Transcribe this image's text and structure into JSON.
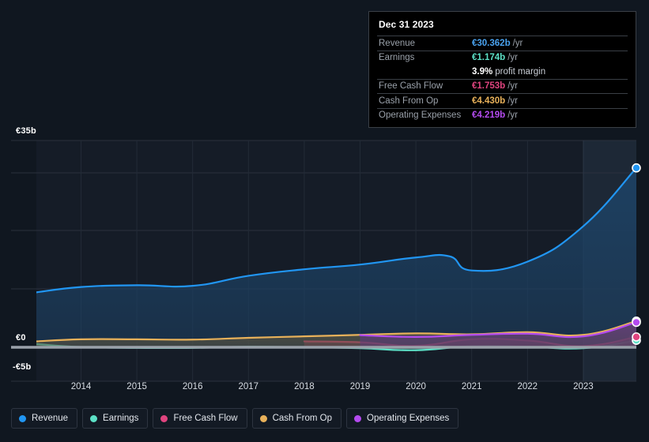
{
  "chart_data": {
    "type": "area",
    "title": "",
    "xlabel": "",
    "ylabel": "",
    "currency": "EUR",
    "x": [
      2013.2,
      2014,
      2015,
      2016,
      2017,
      2018,
      2019,
      2020,
      2021,
      2022,
      2023,
      2023.95
    ],
    "xtick_labels": [
      "2014",
      "2015",
      "2016",
      "2017",
      "2018",
      "2019",
      "2020",
      "2021",
      "2022",
      "2023"
    ],
    "xticks": [
      2014,
      2015,
      2016,
      2017,
      2018,
      2019,
      2020,
      2021,
      2022,
      2023
    ],
    "ytick_labels": [
      "€35b",
      "€0",
      "-€5b"
    ],
    "yticks": [
      35,
      0,
      -5
    ],
    "ylim": [
      -5,
      35
    ],
    "gridlines": [
      35,
      32.5,
      27.5,
      22.5,
      0,
      -5
    ],
    "grid": true,
    "legend_position": "bottom",
    "series": [
      {
        "name": "Revenue",
        "color": "#2196f3",
        "fill": "#1d4265",
        "x": [
          2013.2,
          2014,
          2015,
          2016,
          2017,
          2018,
          2019,
          2020,
          2020.6,
          2021,
          2022,
          2023,
          2023.95
        ],
        "values": [
          9.3,
          10.2,
          10.5,
          10.4,
          12.1,
          13.2,
          14.0,
          15.2,
          15.4,
          13.0,
          14.5,
          20.5,
          30.362
        ],
        "end_label": "€30.362b"
      },
      {
        "name": "Earnings",
        "color": "#5ce0c6",
        "fill": "#3a6b6a",
        "x": [
          2013.2,
          2014,
          2015,
          2016,
          2017,
          2018,
          2019,
          2020,
          2021,
          2022,
          2023,
          2023.95
        ],
        "values": [
          0.55,
          0.05,
          -0.1,
          -0.1,
          0.1,
          0.0,
          -0.15,
          -0.5,
          0.2,
          0.1,
          -0.15,
          1.174
        ],
        "end_label": "€1.174b"
      },
      {
        "name": "Free Cash Flow",
        "color": "#e0447f",
        "fill": "#7a3a5c",
        "x": [
          2018,
          2019,
          2020,
          2021,
          2022,
          2023,
          2023.95
        ],
        "values": [
          1.0,
          0.85,
          0.25,
          1.35,
          1.15,
          0.2,
          1.753
        ],
        "end_label": "€1.753b"
      },
      {
        "name": "Cash From Op",
        "color": "#e8b15a",
        "fill": "#5c5540",
        "x": [
          2013.2,
          2014,
          2015,
          2016,
          2017,
          2018,
          2019,
          2020,
          2021,
          2022,
          2023,
          2023.95
        ],
        "values": [
          1.0,
          1.35,
          1.35,
          1.3,
          1.6,
          1.85,
          2.1,
          2.35,
          2.2,
          2.55,
          2.1,
          4.43
        ],
        "end_label": "€4.430b"
      },
      {
        "name": "Operating Expenses",
        "color": "#b44bf0",
        "fill": "#5e3c7a",
        "x": [
          2019,
          2020,
          2021,
          2022,
          2023,
          2023.95
        ],
        "values": [
          2.05,
          1.75,
          2.1,
          2.3,
          1.85,
          4.219
        ],
        "end_label": "€4.219b"
      }
    ]
  },
  "tooltip": {
    "title": "Dec 31 2023",
    "rows": [
      {
        "key": "Revenue",
        "value": "€30.362b",
        "unit": "/yr",
        "color": "#4aa3f0"
      },
      {
        "key": "Earnings",
        "value": "€1.174b",
        "unit": "/yr",
        "color": "#5ce0c6"
      },
      {
        "key": "",
        "value": "3.9%",
        "unit": "",
        "margin_label": "profit margin",
        "color": "#ffffff"
      },
      {
        "key": "Free Cash Flow",
        "value": "€1.753b",
        "unit": "/yr",
        "color": "#e0447f"
      },
      {
        "key": "Cash From Op",
        "value": "€4.430b",
        "unit": "/yr",
        "color": "#e8b15a"
      },
      {
        "key": "Operating Expenses",
        "value": "€4.219b",
        "unit": "/yr",
        "color": "#b44bf0"
      }
    ]
  },
  "legend": {
    "items": [
      {
        "label": "Revenue",
        "color": "#2196f3"
      },
      {
        "label": "Earnings",
        "color": "#5ce0c6"
      },
      {
        "label": "Free Cash Flow",
        "color": "#e0447f"
      },
      {
        "label": "Cash From Op",
        "color": "#e8b15a"
      },
      {
        "label": "Operating Expenses",
        "color": "#b44bf0"
      }
    ]
  },
  "colors": {
    "background": "#101720",
    "plot_background": "#151c27",
    "grid": "#2a313d",
    "zero_line": "#9aa1aa",
    "forecast_band": "#1a2433"
  }
}
